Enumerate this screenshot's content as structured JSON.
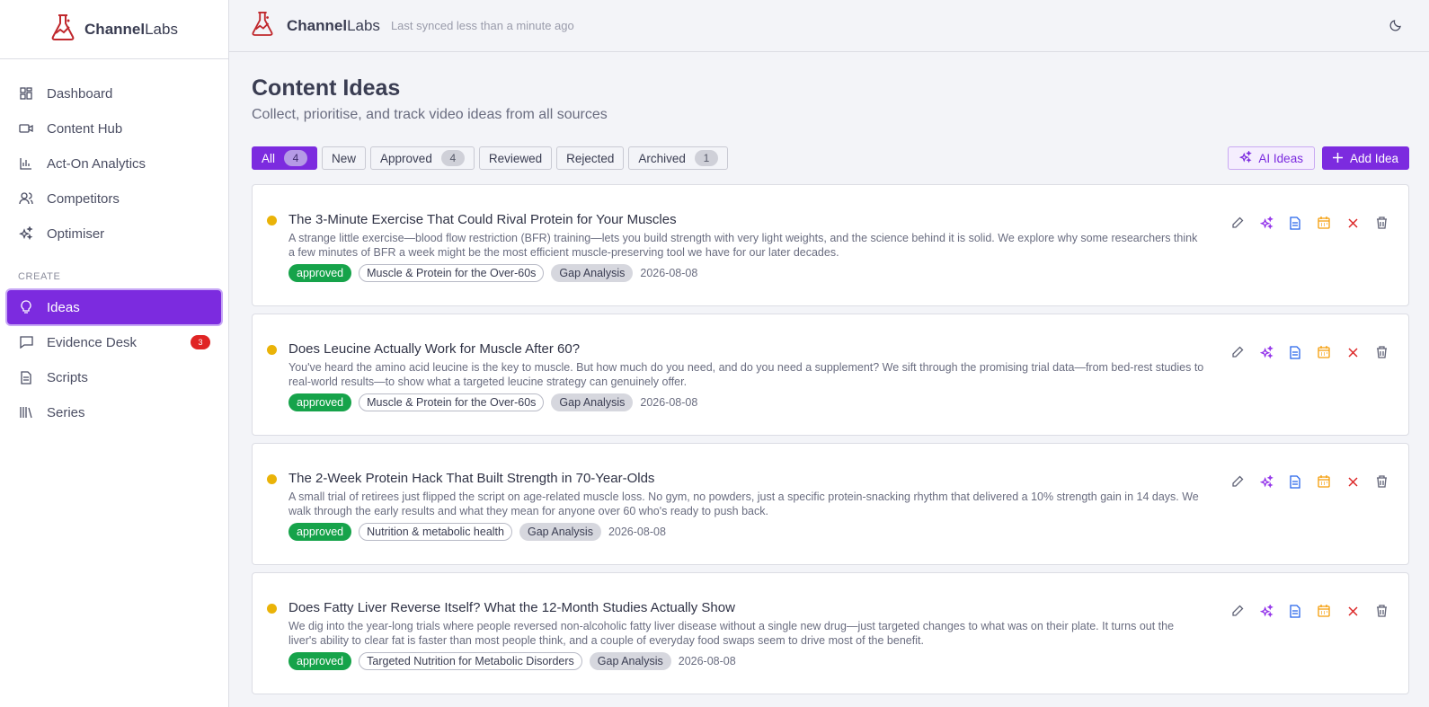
{
  "brand": {
    "bold": "Channel",
    "light": "Labs"
  },
  "topbar": {
    "bold": "Channel",
    "light": "Labs",
    "sync_text": "Last synced less than a minute ago"
  },
  "sidebar": {
    "items": [
      {
        "label": "Dashboard",
        "icon": "dashboard-icon"
      },
      {
        "label": "Content Hub",
        "icon": "video-icon"
      },
      {
        "label": "Act-On Analytics",
        "icon": "bar-chart-icon"
      },
      {
        "label": "Competitors",
        "icon": "users-icon"
      },
      {
        "label": "Optimiser",
        "icon": "sparkles-icon"
      }
    ],
    "section_label": "CREATE",
    "create_items": [
      {
        "label": "Ideas",
        "icon": "lightbulb-icon",
        "active": true
      },
      {
        "label": "Evidence Desk",
        "icon": "message-icon",
        "badge": "3"
      },
      {
        "label": "Scripts",
        "icon": "file-text-icon"
      },
      {
        "label": "Series",
        "icon": "library-icon"
      }
    ]
  },
  "page": {
    "title": "Content Ideas",
    "subtitle": "Collect, prioritise, and track video ideas from all sources"
  },
  "filters": [
    {
      "label": "All",
      "count": "4",
      "active": true
    },
    {
      "label": "New"
    },
    {
      "label": "Approved",
      "count": "4"
    },
    {
      "label": "Reviewed"
    },
    {
      "label": "Rejected"
    },
    {
      "label": "Archived",
      "count": "1"
    }
  ],
  "actions": {
    "ai_ideas": "AI Ideas",
    "add_idea": "Add Idea"
  },
  "ideas": [
    {
      "title": "The 3-Minute Exercise That Could Rival Protein for Your Muscles",
      "description": "A strange little exercise—blood flow restriction (BFR) training—lets you build strength with very light weights, and the science behind it is solid. We explore why some researchers think a few minutes of BFR a week might be the most efficient muscle-preserving tool we have for our later decades.",
      "status": "approved",
      "topic": "Muscle & Protein for the Over-60s",
      "source": "Gap Analysis",
      "date": "2026-08-08"
    },
    {
      "title": "Does Leucine Actually Work for Muscle After 60?",
      "description": "You've heard the amino acid leucine is the key to muscle. But how much do you need, and do you need a supplement? We sift through the promising trial data—from bed-rest studies to real-world results—to show what a targeted leucine strategy can genuinely offer.",
      "status": "approved",
      "topic": "Muscle & Protein for the Over-60s",
      "source": "Gap Analysis",
      "date": "2026-08-08"
    },
    {
      "title": "The 2-Week Protein Hack That Built Strength in 70-Year-Olds",
      "description": "A small trial of retirees just flipped the script on age-related muscle loss. No gym, no powders, just a specific protein-snacking rhythm that delivered a 10% strength gain in 14 days. We walk through the early results and what they mean for anyone over 60 who's ready to push back.",
      "status": "approved",
      "topic": "Nutrition & metabolic health",
      "source": "Gap Analysis",
      "date": "2026-08-08"
    },
    {
      "title": "Does Fatty Liver Reverse Itself? What the 12-Month Studies Actually Show",
      "description": "We dig into the year-long trials where people reversed non-alcoholic fatty liver disease without a single new drug—just targeted changes to what was on their plate. It turns out the liver's ability to clear fat is faster than most people think, and a couple of everyday food swaps seem to drive most of the benefit.",
      "status": "approved",
      "topic": "Targeted Nutrition for Metabolic Disorders",
      "source": "Gap Analysis",
      "date": "2026-08-08"
    }
  ],
  "colors": {
    "accent": "#7c2bdf",
    "approved": "#16a34a",
    "status_dot": "#eab308",
    "badge_red": "#e02424"
  }
}
